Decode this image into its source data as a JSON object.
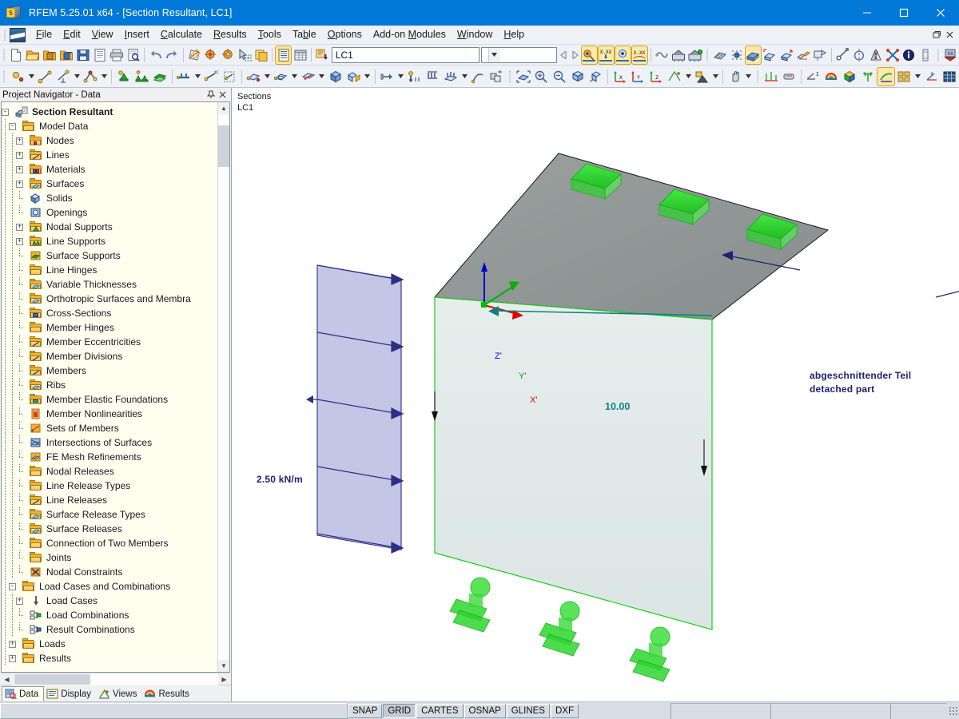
{
  "window": {
    "title": "RFEM 5.25.01 x64 - [Section Resultant, LC1]",
    "app_icon": "rfem-cube-icon",
    "minimize_label": "Minimize",
    "maximize_label": "Maximize",
    "close_label": "Close",
    "mdi_restore_label": "Restore Window",
    "mdi_close_label": "Close Window"
  },
  "menu": {
    "items": [
      {
        "label": "File",
        "accel": "F"
      },
      {
        "label": "Edit",
        "accel": "E"
      },
      {
        "label": "View",
        "accel": "V"
      },
      {
        "label": "Insert",
        "accel": "I"
      },
      {
        "label": "Calculate",
        "accel": "C"
      },
      {
        "label": "Results",
        "accel": "R"
      },
      {
        "label": "Tools",
        "accel": "T"
      },
      {
        "label": "Table",
        "accel": "b"
      },
      {
        "label": "Options",
        "accel": "O"
      },
      {
        "label": "Add-on Modules",
        "accel": "M"
      },
      {
        "label": "Window",
        "accel": "W"
      },
      {
        "label": "Help",
        "accel": "H"
      }
    ]
  },
  "toolbar_main": {
    "load_case_value": "LC1",
    "load_case_placeholder": "Load case",
    "second_combo_value": "",
    "second_combo_placeholder": "",
    "buttons": [
      {
        "name": "new-icon",
        "tip": "New Model"
      },
      {
        "name": "open-icon",
        "tip": "Open Model"
      },
      {
        "name": "open-package-icon",
        "tip": "Open Package"
      },
      {
        "name": "save-package-icon",
        "tip": "Save Package"
      },
      {
        "name": "save-icon",
        "tip": "Save"
      },
      {
        "name": "printout-report-icon",
        "tip": "Printout Report"
      },
      {
        "name": "print-icon",
        "tip": "Print"
      },
      {
        "name": "print-preview-icon",
        "tip": "Print Preview"
      },
      {
        "name": "undo-icon",
        "tip": "Undo"
      },
      {
        "name": "redo-icon",
        "tip": "Redo"
      },
      {
        "name": "edit-model-icon",
        "tip": "Edit Model"
      },
      {
        "name": "find-node-icon",
        "tip": "Find Node"
      },
      {
        "name": "find-object-icon",
        "tip": "Find Object"
      },
      {
        "name": "select-special-icon",
        "tip": "Select Special"
      },
      {
        "name": "copy-layer-icon",
        "tip": "Copy Layer"
      },
      {
        "name": "tables-icon",
        "tip": "Show Tables"
      },
      {
        "name": "grid-table-icon",
        "tip": "Table Grid"
      },
      {
        "name": "import-icon",
        "tip": "Import Data"
      },
      {
        "name": "prev-load-case-icon",
        "tip": "Previous Load Case"
      },
      {
        "name": "next-load-case-icon",
        "tip": "Next Load Case"
      },
      {
        "name": "results-on-off-icon",
        "tip": "Show Results"
      },
      {
        "name": "result-values-icon",
        "tip": "Show Result Values"
      },
      {
        "name": "deformation-icon",
        "tip": "Show Deformation"
      },
      {
        "name": "result-diagram-icon",
        "tip": "Result Diagram"
      },
      {
        "name": "animation-icon",
        "tip": "Animation"
      },
      {
        "name": "calculate-icon",
        "tip": "Calculate"
      },
      {
        "name": "calculate-all-icon",
        "tip": "Calculate All"
      },
      {
        "name": "fe-mesh-icon",
        "tip": "FE Mesh"
      },
      {
        "name": "mesh-settings-icon",
        "tip": "FE Mesh Settings"
      },
      {
        "name": "rendering-icon",
        "tip": "Rendering"
      },
      {
        "name": "model-view-icon",
        "tip": "Model View"
      },
      {
        "name": "solid-view-icon",
        "tip": "Solid View"
      },
      {
        "name": "wire-view-icon",
        "tip": "Wire View"
      },
      {
        "name": "visibility-icon",
        "tip": "Visibilities"
      },
      {
        "name": "measure-icon",
        "tip": "Measure"
      },
      {
        "name": "circle-tool-icon",
        "tip": "Circle"
      },
      {
        "name": "mirror-icon",
        "tip": "Mirror"
      },
      {
        "name": "delete-x-icon",
        "tip": "Delete"
      },
      {
        "name": "info-icon",
        "tip": "Info"
      },
      {
        "name": "column-icon",
        "tip": "Columns"
      },
      {
        "name": "stamp-icon",
        "tip": "Stamp"
      }
    ]
  },
  "toolbar_model": {
    "buttons": [
      {
        "name": "new-node-icon",
        "tip": "New Node"
      },
      {
        "name": "new-line-icon",
        "tip": "New Line"
      },
      {
        "name": "new-line-dim-icon",
        "tip": "New Dimension Line"
      },
      {
        "name": "new-polyline-icon",
        "tip": "New Polyline"
      },
      {
        "name": "new-nodal-support-icon",
        "tip": "New Nodal Support"
      },
      {
        "name": "new-line-support-icon",
        "tip": "New Line Support"
      },
      {
        "name": "new-surface-support-icon",
        "tip": "New Surface Support"
      },
      {
        "name": "new-member-icon",
        "tip": "New Member"
      },
      {
        "name": "new-member-nx-icon",
        "tip": "New Member with Axial Force"
      },
      {
        "name": "new-member-set-icon",
        "tip": "New Set of Members"
      },
      {
        "name": "new-surface-icon",
        "tip": "New Surface"
      },
      {
        "name": "new-opening-icon",
        "tip": "New Opening"
      },
      {
        "name": "new-rib-icon",
        "tip": "New Rib"
      },
      {
        "name": "new-solid-icon",
        "tip": "New Solid"
      },
      {
        "name": "new-solid-contact-icon",
        "tip": "New Solid Contact"
      },
      {
        "name": "new-nodal-load-icon",
        "tip": "New Nodal Load"
      },
      {
        "name": "new-free-load-icon",
        "tip": "New Free Load"
      },
      {
        "name": "new-line-load-icon",
        "tip": "New Line Load"
      },
      {
        "name": "new-surface-load-icon",
        "tip": "New Surface Load"
      },
      {
        "name": "new-member-load-icon",
        "tip": "New Member Load"
      },
      {
        "name": "new-imperfection-icon",
        "tip": "New Imperfection"
      },
      {
        "name": "move-copy-icon",
        "tip": "Move / Copy"
      },
      {
        "name": "zoom-in-icon",
        "tip": "Zoom In"
      },
      {
        "name": "zoom-out-icon",
        "tip": "Zoom Out"
      },
      {
        "name": "zoom-all-icon",
        "tip": "Show Whole Model"
      },
      {
        "name": "zoom-window-icon",
        "tip": "Zoom by Window"
      },
      {
        "name": "view-x-icon",
        "tip": "View in X Direction"
      },
      {
        "name": "view-y-icon",
        "tip": "View in Y Direction"
      },
      {
        "name": "view-z-icon",
        "tip": "View in Z Direction"
      },
      {
        "name": "view-isometric-icon",
        "tip": "Isometric View"
      },
      {
        "name": "view-perspective-icon",
        "tip": "Perspective"
      },
      {
        "name": "pan-hand-icon",
        "tip": "Pan View"
      },
      {
        "name": "section-icon",
        "tip": "Sections"
      },
      {
        "name": "clipping-icon",
        "tip": "Clipping Plane"
      },
      {
        "name": "support-reactions-icon",
        "tip": "Support Reactions"
      },
      {
        "name": "color-scale-icon",
        "tip": "Color Scale"
      },
      {
        "name": "solid-results-icon",
        "tip": "Results on Solids"
      },
      {
        "name": "surface-results-icon",
        "tip": "Results on Surfaces"
      },
      {
        "name": "section-resultant-icon",
        "tip": "Section Resultant"
      },
      {
        "name": "windows-tile-icon",
        "tip": "Tile Windows"
      },
      {
        "name": "load-wizard-icon",
        "tip": "Load Wizard"
      },
      {
        "name": "grid-display-icon",
        "tip": "Display Grid"
      }
    ]
  },
  "navigator": {
    "title": "Project Navigator - Data",
    "pin_label": "Auto Hide",
    "close_label": "Close",
    "scroll_up_label": "Scroll Up",
    "scroll_down_label": "Scroll Down",
    "scroll_left_label": "Scroll Left",
    "scroll_right_label": "Scroll Right",
    "tree": [
      {
        "label": "Section Resultant",
        "depth": 0,
        "toggle": "-",
        "icon": "model-icon",
        "bold": true
      },
      {
        "label": "Model Data",
        "depth": 1,
        "toggle": "-",
        "icon": "folder-plain-icon"
      },
      {
        "label": "Nodes",
        "depth": 2,
        "toggle": "+",
        "icon": "folder-node-icon"
      },
      {
        "label": "Lines",
        "depth": 2,
        "toggle": "+",
        "icon": "folder-line-icon"
      },
      {
        "label": "Materials",
        "depth": 2,
        "toggle": "+",
        "icon": "folder-material-icon"
      },
      {
        "label": "Surfaces",
        "depth": 2,
        "toggle": "+",
        "icon": "folder-surface-icon"
      },
      {
        "label": "Solids",
        "depth": 2,
        "toggle": "",
        "icon": "solid-icon"
      },
      {
        "label": "Openings",
        "depth": 2,
        "toggle": "",
        "icon": "opening-icon"
      },
      {
        "label": "Nodal Supports",
        "depth": 2,
        "toggle": "+",
        "icon": "folder-nodal-support-icon"
      },
      {
        "label": "Line Supports",
        "depth": 2,
        "toggle": "+",
        "icon": "folder-line-support-icon"
      },
      {
        "label": "Surface Supports",
        "depth": 2,
        "toggle": "",
        "icon": "surface-support-icon"
      },
      {
        "label": "Line Hinges",
        "depth": 2,
        "toggle": "",
        "icon": "folder-plain-icon"
      },
      {
        "label": "Variable Thicknesses",
        "depth": 2,
        "toggle": "",
        "icon": "folder-surface-icon"
      },
      {
        "label": "Orthotropic Surfaces and Membra",
        "depth": 2,
        "toggle": "",
        "icon": "folder-surface-icon"
      },
      {
        "label": "Cross-Sections",
        "depth": 2,
        "toggle": "",
        "icon": "folder-section-icon"
      },
      {
        "label": "Member Hinges",
        "depth": 2,
        "toggle": "",
        "icon": "folder-plain-icon"
      },
      {
        "label": "Member Eccentricities",
        "depth": 2,
        "toggle": "",
        "icon": "folder-line-icon"
      },
      {
        "label": "Member Divisions",
        "depth": 2,
        "toggle": "",
        "icon": "folder-line-icon"
      },
      {
        "label": "Members",
        "depth": 2,
        "toggle": "",
        "icon": "folder-line-icon"
      },
      {
        "label": "Ribs",
        "depth": 2,
        "toggle": "",
        "icon": "folder-surface-icon"
      },
      {
        "label": "Member Elastic Foundations",
        "depth": 2,
        "toggle": "",
        "icon": "folder-foundation-icon"
      },
      {
        "label": "Member Nonlinearities",
        "depth": 2,
        "toggle": "",
        "icon": "nonlinearity-icon"
      },
      {
        "label": "Sets of Members",
        "depth": 2,
        "toggle": "",
        "icon": "member-set-icon"
      },
      {
        "label": "Intersections of Surfaces",
        "depth": 2,
        "toggle": "",
        "icon": "intersection-icon"
      },
      {
        "label": "FE Mesh Refinements",
        "depth": 2,
        "toggle": "",
        "icon": "fe-mesh-icon"
      },
      {
        "label": "Nodal Releases",
        "depth": 2,
        "toggle": "",
        "icon": "folder-empty-icon"
      },
      {
        "label": "Line Release Types",
        "depth": 2,
        "toggle": "",
        "icon": "folder-empty-icon"
      },
      {
        "label": "Line Releases",
        "depth": 2,
        "toggle": "",
        "icon": "folder-line-icon"
      },
      {
        "label": "Surface Release Types",
        "depth": 2,
        "toggle": "",
        "icon": "folder-surface-icon"
      },
      {
        "label": "Surface Releases",
        "depth": 2,
        "toggle": "",
        "icon": "folder-surface-icon"
      },
      {
        "label": "Connection of Two Members",
        "depth": 2,
        "toggle": "",
        "icon": "folder-empty-icon"
      },
      {
        "label": "Joints",
        "depth": 2,
        "toggle": "",
        "icon": "folder-empty-icon"
      },
      {
        "label": "Nodal Constraints",
        "depth": 2,
        "toggle": "",
        "icon": "nodal-constraint-icon"
      },
      {
        "label": "Load Cases and Combinations",
        "depth": 1,
        "toggle": "-",
        "icon": "folder-plain-icon"
      },
      {
        "label": "Load Cases",
        "depth": 2,
        "toggle": "+",
        "icon": "load-case-icon"
      },
      {
        "label": "Load Combinations",
        "depth": 2,
        "toggle": "",
        "icon": "load-combination-icon"
      },
      {
        "label": "Result Combinations",
        "depth": 2,
        "toggle": "",
        "icon": "result-combination-icon"
      },
      {
        "label": "Loads",
        "depth": 1,
        "toggle": "+",
        "icon": "folder-plain-icon"
      },
      {
        "label": "Results",
        "depth": 1,
        "toggle": "+",
        "icon": "folder-plain-icon"
      }
    ],
    "tabs": [
      {
        "label": "Data",
        "icon": "data-tab-icon",
        "selected": true
      },
      {
        "label": "Display",
        "icon": "display-tab-icon",
        "selected": false
      },
      {
        "label": "Views",
        "icon": "views-tab-icon",
        "selected": false
      },
      {
        "label": "Results",
        "icon": "results-tab-icon",
        "selected": false
      }
    ]
  },
  "viewport": {
    "header_line1": "Sections",
    "header_line2": "LC1",
    "load_label": "2.50 kN/m",
    "dimension_label": "10.00",
    "annotation_line1": "abgeschnittender Teil",
    "annotation_line2": "detached part",
    "axis_z": "Z'",
    "axis_y": "Y'",
    "axis_x": "X'",
    "colors": {
      "top_surface": "#8f9695",
      "front_surface": "#dfe8e6",
      "load_area": "#c3c6e4",
      "load_arrow": "#2b2f85",
      "support_green": "#22d622",
      "dimension_teal": "#0f8080",
      "annotation_navy": "#1f2270",
      "edge_green": "#18d018"
    }
  },
  "statusbar": {
    "buttons": [
      {
        "label": "SNAP",
        "active": false
      },
      {
        "label": "GRID",
        "active": true
      },
      {
        "label": "CARTES",
        "active": false
      },
      {
        "label": "OSNAP",
        "active": false
      },
      {
        "label": "GLINES",
        "active": false
      },
      {
        "label": "DXF",
        "active": false
      }
    ],
    "pane_left": "",
    "pane_2": "",
    "pane_3": "",
    "pane_4": ""
  }
}
